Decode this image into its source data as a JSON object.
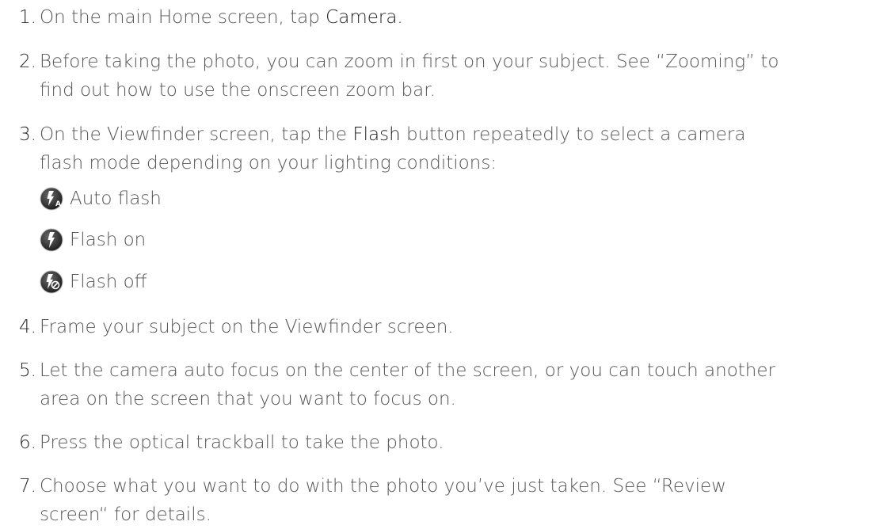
{
  "steps": [
    {
      "num": "1.",
      "parts": [
        "On the main Home screen, tap ",
        "Camera."
      ]
    },
    {
      "num": "2.",
      "line1": "Before taking the photo, you can zoom in first on your subject. See “Zooming” to",
      "line2": "find out how to use the onscreen zoom bar."
    },
    {
      "num": "3.",
      "line1a": "On the Viewfinder screen, tap the ",
      "line1b": "Flash",
      "line1c": " button repeatedly to select a camera",
      "line2": "flash mode depending on your lighting conditions:"
    },
    {
      "num": "4.",
      "text": "Frame your subject on the Viewfinder screen."
    },
    {
      "num": "5.",
      "line1": "Let the camera auto focus on the center of the screen, or you can touch another",
      "line2": "area on the screen that you want to focus on."
    },
    {
      "num": "6.",
      "text": "Press the optical trackball to take the photo."
    },
    {
      "num": "7.",
      "line1": "Choose what you want to do with the photo you’ve just taken. See “Review",
      "line2": "screen“ for details."
    }
  ],
  "flash_modes": [
    {
      "icon": "auto-flash-icon",
      "label": "Auto flash"
    },
    {
      "icon": "flash-on-icon",
      "label": "Flash on"
    },
    {
      "icon": "flash-off-icon",
      "label": "Flash off"
    }
  ]
}
